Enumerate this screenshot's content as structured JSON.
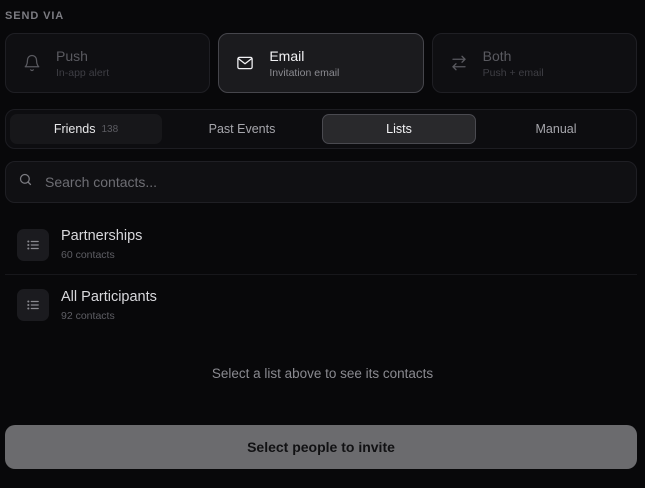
{
  "send_via": {
    "label": "SEND VIA",
    "options": [
      {
        "title": "Push",
        "subtitle": "In-app alert",
        "icon": "bell-icon",
        "selected": false
      },
      {
        "title": "Email",
        "subtitle": "Invitation email",
        "icon": "mail-icon",
        "selected": true
      },
      {
        "title": "Both",
        "subtitle": "Push + email",
        "icon": "arrows-swap-icon",
        "selected": false
      }
    ]
  },
  "tabs": [
    {
      "label": "Friends",
      "count": "138"
    },
    {
      "label": "Past Events"
    },
    {
      "label": "Lists",
      "active": true
    },
    {
      "label": "Manual"
    }
  ],
  "search": {
    "placeholder": "Search contacts...",
    "value": ""
  },
  "lists": [
    {
      "name": "Partnerships",
      "count": "60 contacts"
    },
    {
      "name": "All Participants",
      "count": "92 contacts"
    }
  ],
  "hint": "Select a list above to see its contacts",
  "cta": {
    "label": "Select people to invite"
  },
  "colors": {
    "background": "#08080a",
    "cta_background": "#6b6b6e",
    "selected_border": "#46464c"
  }
}
